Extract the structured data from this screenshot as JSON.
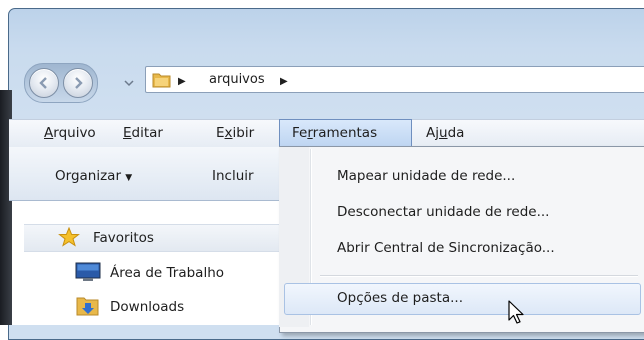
{
  "address": {
    "path": [
      {
        "label": "arquivos"
      }
    ]
  },
  "menubar": {
    "items": [
      {
        "pre": "",
        "acc": "A",
        "post": "rquivo"
      },
      {
        "pre": "",
        "acc": "E",
        "post": "ditar"
      },
      {
        "pre": "E",
        "acc": "x",
        "post": "ibir"
      },
      {
        "pre": "Fe",
        "acc": "r",
        "post": "ramentas"
      },
      {
        "pre": "Aj",
        "acc": "u",
        "post": "da"
      }
    ]
  },
  "toolbar": {
    "organize_label": "Organizar",
    "include_label": "Incluir"
  },
  "nav_pane": {
    "favorites_label": "Favoritos",
    "items": [
      {
        "label": "Área de Trabalho"
      },
      {
        "label": "Downloads"
      }
    ]
  },
  "tools_menu": {
    "items": [
      {
        "label": "Mapear unidade de rede..."
      },
      {
        "label": "Desconectar unidade de rede..."
      },
      {
        "label": "Abrir Central de Sincronização..."
      },
      {
        "label": "Opções de pasta..."
      }
    ]
  },
  "colors": {
    "highlight_border": "#a9c2e4",
    "menu_active_bg": "#c6daf3",
    "window_frame": "#cfdff0"
  }
}
